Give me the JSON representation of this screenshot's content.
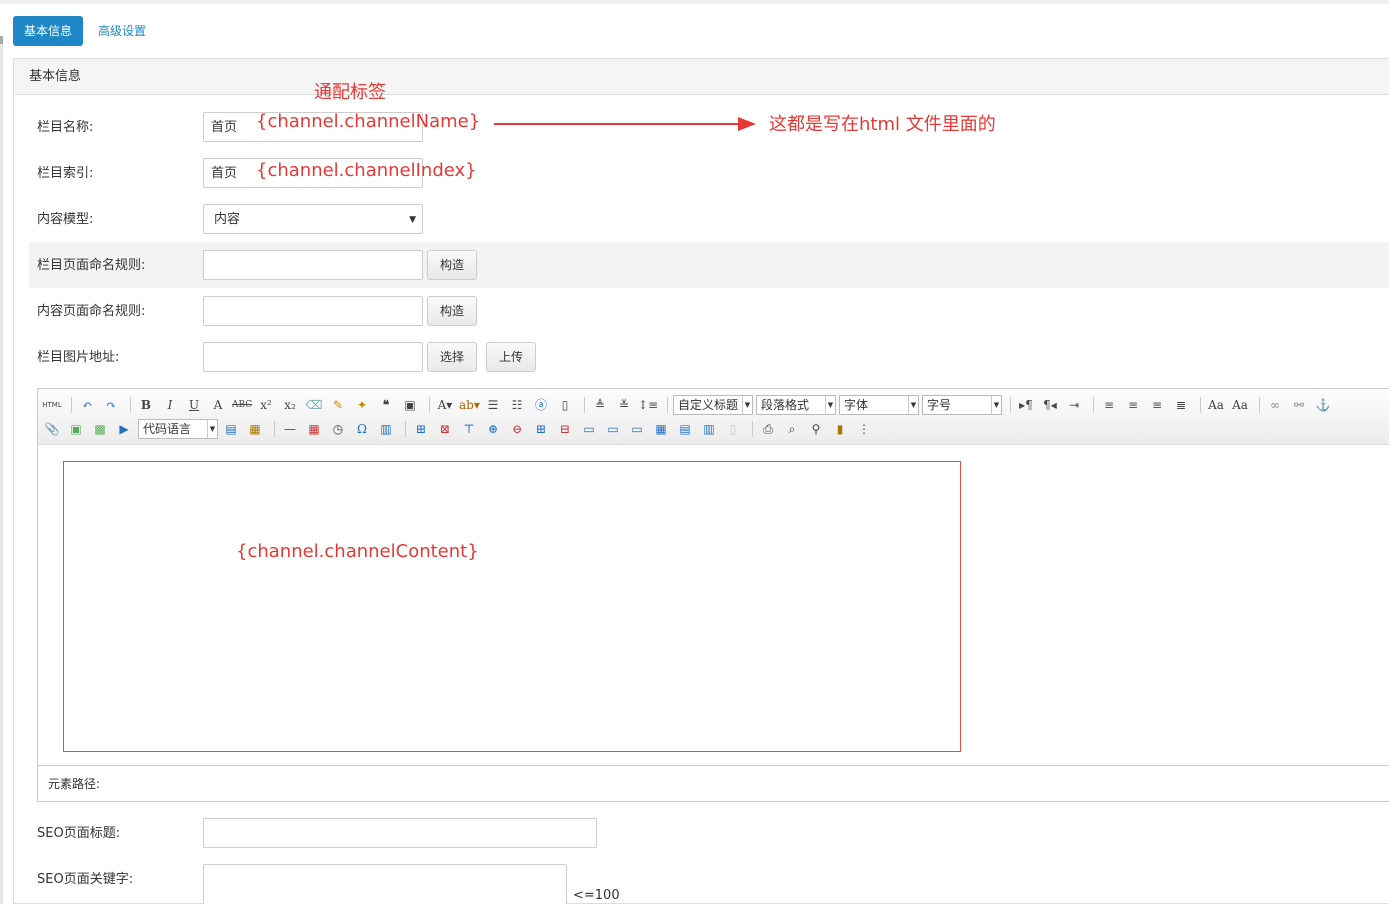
{
  "tabs": {
    "basic": "基本信息",
    "advanced": "高级设置"
  },
  "panel": {
    "title": "基本信息"
  },
  "fields": {
    "channel_name": {
      "label": "栏目名称:",
      "value": "首页"
    },
    "channel_index": {
      "label": "栏目索引:",
      "value": "首页"
    },
    "content_model": {
      "label": "内容模型:",
      "value": "内容"
    },
    "channel_rule": {
      "label": "栏目页面命名规则:",
      "button": "构造"
    },
    "content_rule": {
      "label": "内容页面命名规则:",
      "button": "构造"
    },
    "channel_image": {
      "label": "栏目图片地址:",
      "select_button": "选择",
      "upload_button": "上传"
    },
    "seo_title": {
      "label": "SEO页面标题:"
    },
    "seo_keywords": {
      "label": "SEO页面关键字:",
      "hint": "<=100"
    }
  },
  "editor": {
    "combos": {
      "custom_title": "自定义标题",
      "paragraph": "段落格式",
      "font": "字体",
      "size": "字号",
      "code_lang": "代码语言"
    },
    "footer": "元素路径:"
  },
  "annotations": {
    "wildcard": "通配标签",
    "name_tag": "{channel.channelName}",
    "index_tag": "{channel.channelIndex}",
    "note": "这都是写在html 文件里面的",
    "content_tag": "{channel.channelContent}"
  },
  "colors": {
    "accent": "#1e88c7",
    "annotation": "#e53935"
  }
}
